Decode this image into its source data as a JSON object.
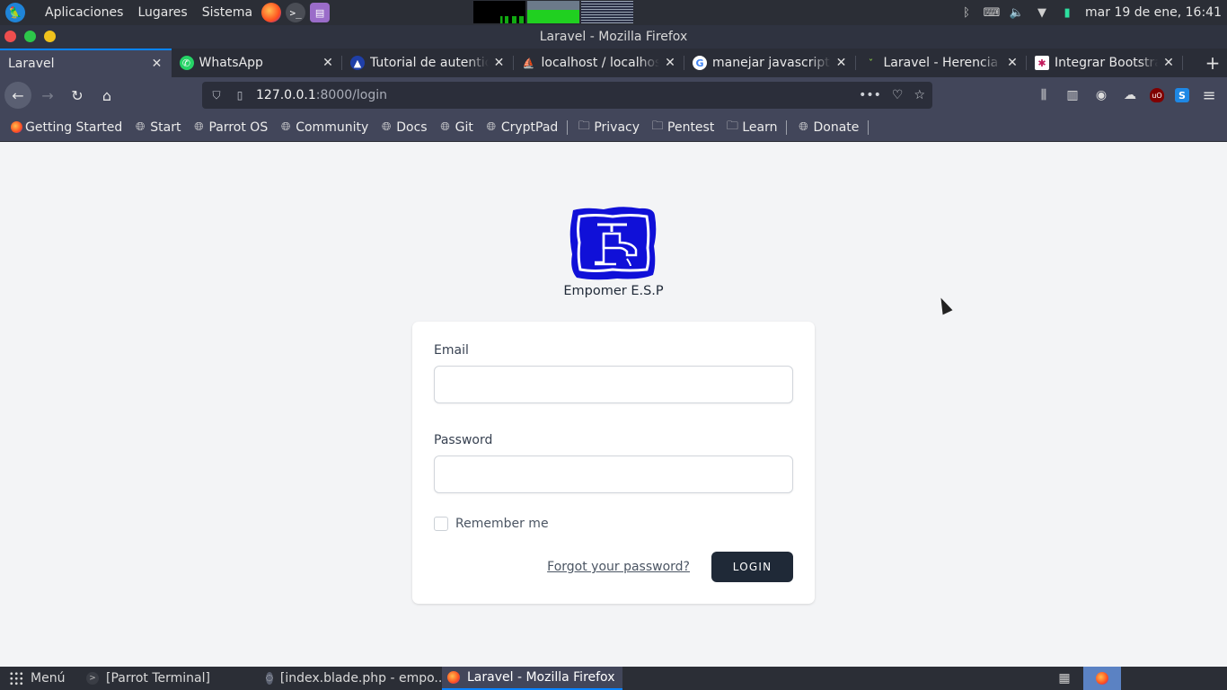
{
  "system_panel": {
    "menus": [
      "Aplicaciones",
      "Lugares",
      "Sistema"
    ],
    "clock": "mar 19 de ene, 16:41"
  },
  "window": {
    "title": "Laravel - Mozilla Firefox"
  },
  "tabs": [
    {
      "label": "Laravel",
      "icon": "none",
      "active": true
    },
    {
      "label": "WhatsApp",
      "icon": "whatsapp-icon"
    },
    {
      "label": "Tutorial de autenticación",
      "icon": "rocket-icon"
    },
    {
      "label": "localhost / localhost",
      "icon": "phpmyadmin-icon"
    },
    {
      "label": "manejar javascript y",
      "icon": "google-icon"
    },
    {
      "label": "Laravel - Herencia de",
      "icon": "favicon-icon"
    },
    {
      "label": "Integrar Bootstrap c",
      "icon": "bootstrap-icon"
    }
  ],
  "urlbar": {
    "host": "127.0.0.1",
    "path": ":8000/login"
  },
  "bookmarks": [
    {
      "label": "Getting Started",
      "icon": "firefox-icon"
    },
    {
      "label": "Start",
      "icon": "globe-icon"
    },
    {
      "label": "Parrot OS",
      "icon": "globe-icon"
    },
    {
      "label": "Community",
      "icon": "globe-icon"
    },
    {
      "label": "Docs",
      "icon": "globe-icon"
    },
    {
      "label": "Git",
      "icon": "globe-icon"
    },
    {
      "label": "CryptPad",
      "icon": "globe-icon"
    },
    {
      "label": "Privacy",
      "icon": "folder-icon"
    },
    {
      "label": "Pentest",
      "icon": "folder-icon"
    },
    {
      "label": "Learn",
      "icon": "folder-icon"
    },
    {
      "label": "Donate",
      "icon": "globe-icon"
    }
  ],
  "login": {
    "brand_name": "Empomer E.S.P",
    "email_label": "Email",
    "email_value": "",
    "password_label": "Password",
    "password_value": "",
    "remember_label": "Remember me",
    "forgot_label": "Forgot your password?",
    "login_label": "LOGIN"
  },
  "taskbar": {
    "menu_label": "Menú",
    "tasks": [
      {
        "label": "[Parrot Terminal]"
      },
      {
        "label": "[index.blade.php - empo..."
      },
      {
        "label": "Laravel - Mozilla Firefox",
        "active": true
      }
    ]
  },
  "colors": {
    "accent": "#0a84ff",
    "login_button": "#1f2937",
    "logo_blue": "#1010d8"
  }
}
